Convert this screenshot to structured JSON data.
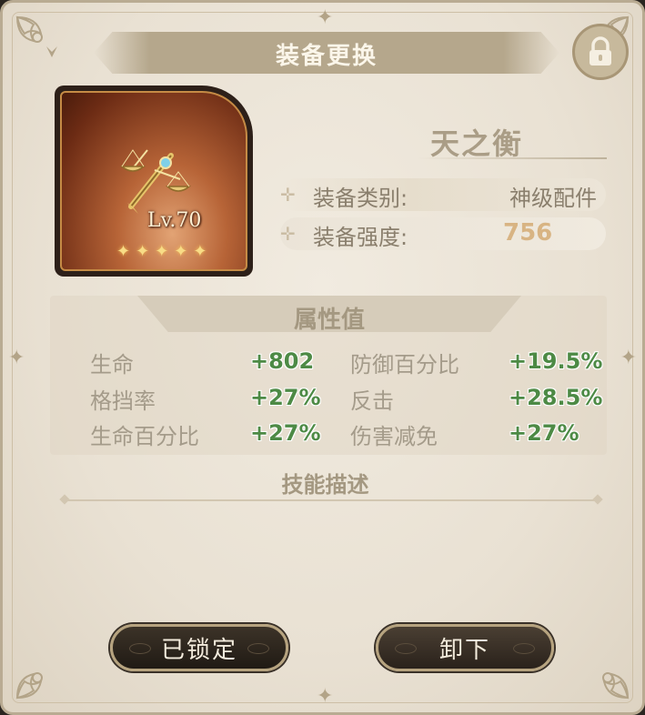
{
  "header": {
    "title": "装备更换"
  },
  "lock_icon": "padlock-icon",
  "item": {
    "level": "Lv.70",
    "star_count": 5,
    "icon": "golden-scales-icon",
    "name": "天之衡"
  },
  "info": {
    "type_label": "装备类别:",
    "type_value": "神级配件",
    "strength_label": "装备强度:",
    "strength_value": "756"
  },
  "attributes": {
    "title": "属性值",
    "rows": [
      {
        "name": "生命",
        "value": "+802",
        "name2": "防御百分比",
        "value2": "+19.5%"
      },
      {
        "name": "格挡率",
        "value": "+27%",
        "name2": "反击",
        "value2": "+28.5%"
      },
      {
        "name": "生命百分比",
        "value": "+27%",
        "name2": "伤害减免",
        "value2": "+27%"
      }
    ]
  },
  "skill": {
    "title": "技能描述"
  },
  "buttons": {
    "lock_label": "已锁定",
    "unequip_label": "卸下"
  },
  "colors": {
    "stat_green": "#4d8a45",
    "strength_gold": "#d8b483",
    "panel_bg": "#ece5d8"
  }
}
